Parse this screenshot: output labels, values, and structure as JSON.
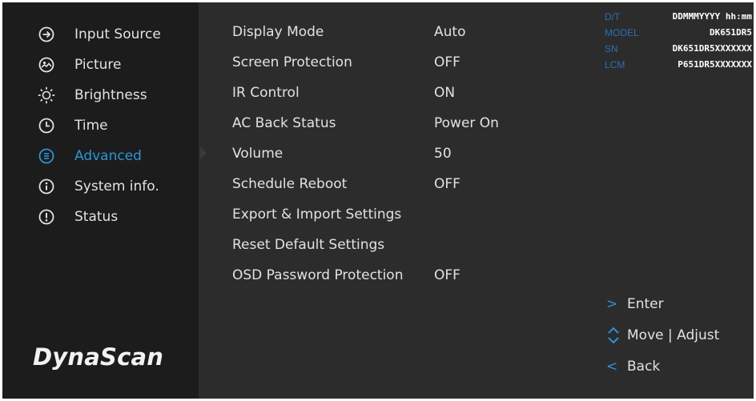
{
  "colors": {
    "panel": "#2c2c2c",
    "sidebar": "#1c1c1c",
    "accent": "#2b95d6",
    "text": "#e2e2e2"
  },
  "sidebar": {
    "items": [
      {
        "label": "Input Source",
        "icon": "input-source-icon"
      },
      {
        "label": "Picture",
        "icon": "picture-icon"
      },
      {
        "label": "Brightness",
        "icon": "brightness-icon"
      },
      {
        "label": "Time",
        "icon": "clock-icon"
      },
      {
        "label": "Advanced",
        "icon": "advanced-icon",
        "active": true
      },
      {
        "label": "System info.",
        "icon": "info-icon"
      },
      {
        "label": "Status",
        "icon": "status-icon"
      }
    ],
    "logo": "DynaScan"
  },
  "settings": [
    {
      "label": "Display Mode",
      "value": "Auto"
    },
    {
      "label": "Screen Protection",
      "value": "OFF"
    },
    {
      "label": "IR Control",
      "value": "ON"
    },
    {
      "label": "AC Back Status",
      "value": "Power On"
    },
    {
      "label": "Volume",
      "value": "50"
    },
    {
      "label": "Schedule Reboot",
      "value": "OFF"
    },
    {
      "label": "Export & Import Settings",
      "value": ""
    },
    {
      "label": "Reset Default Settings",
      "value": ""
    },
    {
      "label": "OSD Password Protection",
      "value": "OFF"
    }
  ],
  "info": [
    {
      "key": "D/T",
      "value": "DDMMMYYYY hh:mm"
    },
    {
      "key": "MODEL",
      "value": "DK651DR5"
    },
    {
      "key": "SN",
      "value": "DK651DR5XXXXXXX"
    },
    {
      "key": "LCM",
      "value": "P651DR5XXXXXXX"
    }
  ],
  "hints": [
    {
      "icon": ">",
      "icon_name": "enter-icon",
      "label": "Enter"
    },
    {
      "icon": "",
      "icon_name": "up-down-icon",
      "label": "Move | Adjust"
    },
    {
      "icon": "<",
      "icon_name": "back-icon",
      "label": "Back"
    }
  ]
}
